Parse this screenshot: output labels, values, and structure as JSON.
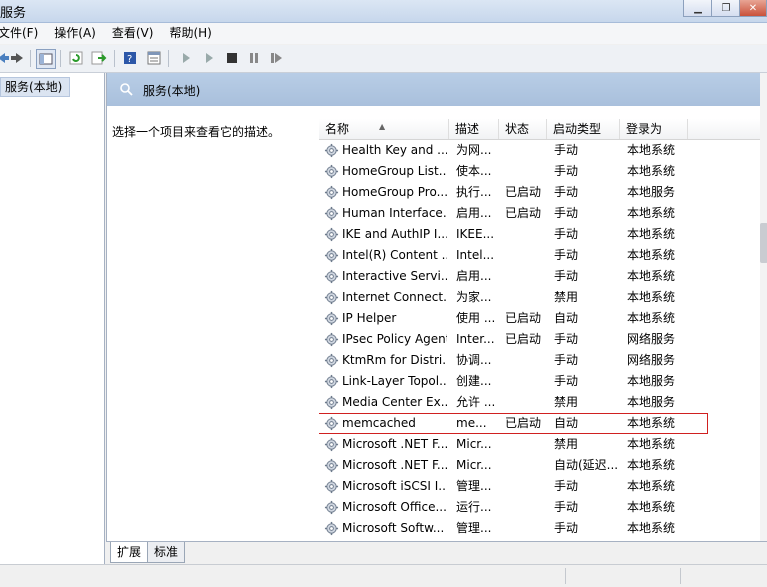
{
  "window": {
    "title": "服务"
  },
  "menu": [
    "文件(F)",
    "操作(A)",
    "查看(V)",
    "帮助(H)"
  ],
  "tree": {
    "selected": "服务(本地)"
  },
  "banner": {
    "title": "服务(本地)"
  },
  "description_prompt": "选择一个项目来查看它的描述。",
  "columns": [
    "名称",
    "描述",
    "状态",
    "启动类型",
    "登录为"
  ],
  "rows": [
    {
      "name": "Health Key and ...",
      "desc": "为网...",
      "status": "",
      "startup": "手动",
      "logon": "本地系统"
    },
    {
      "name": "HomeGroup List...",
      "desc": "使本...",
      "status": "",
      "startup": "手动",
      "logon": "本地系统"
    },
    {
      "name": "HomeGroup Pro...",
      "desc": "执行...",
      "status": "已启动",
      "startup": "手动",
      "logon": "本地服务"
    },
    {
      "name": "Human Interface...",
      "desc": "启用...",
      "status": "已启动",
      "startup": "手动",
      "logon": "本地系统"
    },
    {
      "name": "IKE and AuthIP I...",
      "desc": "IKEE...",
      "status": "",
      "startup": "手动",
      "logon": "本地系统"
    },
    {
      "name": "Intel(R) Content ...",
      "desc": "Intel...",
      "status": "",
      "startup": "手动",
      "logon": "本地系统"
    },
    {
      "name": "Interactive Servi...",
      "desc": "启用...",
      "status": "",
      "startup": "手动",
      "logon": "本地系统"
    },
    {
      "name": "Internet Connect...",
      "desc": "为家...",
      "status": "",
      "startup": "禁用",
      "logon": "本地系统"
    },
    {
      "name": "IP Helper",
      "desc": "使用 ...",
      "status": "已启动",
      "startup": "自动",
      "logon": "本地系统"
    },
    {
      "name": "IPsec Policy Agent",
      "desc": "Inter...",
      "status": "已启动",
      "startup": "手动",
      "logon": "网络服务"
    },
    {
      "name": "KtmRm for Distri...",
      "desc": "协调...",
      "status": "",
      "startup": "手动",
      "logon": "网络服务"
    },
    {
      "name": "Link-Layer Topol...",
      "desc": "创建...",
      "status": "",
      "startup": "手动",
      "logon": "本地服务"
    },
    {
      "name": "Media Center Ex...",
      "desc": "允许 ...",
      "status": "",
      "startup": "禁用",
      "logon": "本地服务"
    },
    {
      "name": "memcached",
      "desc": "me...",
      "status": "已启动",
      "startup": "自动",
      "logon": "本地系统",
      "highlighted": true
    },
    {
      "name": "Microsoft .NET F...",
      "desc": "Micr...",
      "status": "",
      "startup": "禁用",
      "logon": "本地系统"
    },
    {
      "name": "Microsoft .NET F...",
      "desc": "Micr...",
      "status": "",
      "startup": "自动(延迟...",
      "logon": "本地系统"
    },
    {
      "name": "Microsoft iSCSI I...",
      "desc": "管理...",
      "status": "",
      "startup": "手动",
      "logon": "本地系统"
    },
    {
      "name": "Microsoft Office...",
      "desc": "运行...",
      "status": "",
      "startup": "手动",
      "logon": "本地系统"
    },
    {
      "name": "Microsoft Softw...",
      "desc": "管理...",
      "status": "",
      "startup": "手动",
      "logon": "本地系统"
    }
  ],
  "tabs": [
    "扩展",
    "标准"
  ],
  "colors": {
    "highlight_border": "#d02020",
    "banner": "#b8cde6"
  }
}
